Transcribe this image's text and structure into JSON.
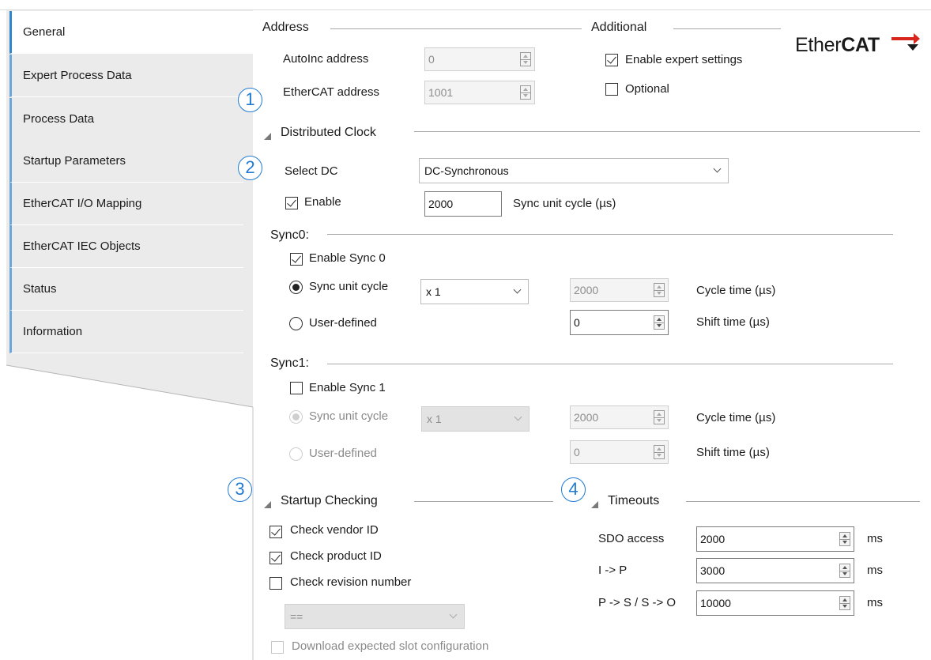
{
  "tabs": [
    {
      "label": "General",
      "active": true
    },
    {
      "label": "Expert Process Data",
      "active": false
    },
    {
      "label": "Process Data",
      "active": false
    },
    {
      "label": "Startup Parameters",
      "active": false
    },
    {
      "label": "EtherCAT I/O Mapping",
      "active": false
    },
    {
      "label": "EtherCAT IEC Objects",
      "active": false
    },
    {
      "label": "Status",
      "active": false
    },
    {
      "label": "Information",
      "active": false
    }
  ],
  "markers": [
    "1",
    "2",
    "3",
    "4"
  ],
  "address": {
    "title": "Address",
    "autoinc_label": "AutoInc address",
    "autoinc_value": "0",
    "ethercat_label": "EtherCAT address",
    "ethercat_value": "1001"
  },
  "additional": {
    "title": "Additional",
    "expert_label": "Enable expert settings",
    "expert_checked": true,
    "optional_label": "Optional",
    "optional_checked": false
  },
  "logo": {
    "text_plain": "Ether",
    "text_bold": "CAT",
    "icon": "ethercat-logo-arrow",
    "accent": "#d9261c"
  },
  "dc": {
    "title": "Distributed Clock",
    "select_label": "Select DC",
    "select_value": "DC-Synchronous",
    "enable_label": "Enable",
    "enable_checked": true,
    "cycle_value": "2000",
    "cycle_label": "Sync unit cycle (µs)"
  },
  "sync0": {
    "title": "Sync0:",
    "enable_label": "Enable Sync 0",
    "enable_checked": true,
    "radio_cycle_label": "Sync unit cycle",
    "multiplier": "x 1",
    "cycle_value": "2000",
    "cycle_time_label": "Cycle time (µs)",
    "radio_user_label": "User-defined",
    "shift_value": "0",
    "shift_time_label": "Shift time (µs)"
  },
  "sync1": {
    "title": "Sync1:",
    "enable_label": "Enable Sync 1",
    "enable_checked": false,
    "radio_cycle_label": "Sync unit cycle",
    "multiplier": "x 1",
    "cycle_value": "2000",
    "cycle_time_label": "Cycle time (µs)",
    "radio_user_label": "User-defined",
    "shift_value": "0",
    "shift_time_label": "Shift time (µs)"
  },
  "startup": {
    "title": "Startup Checking",
    "vendor_label": "Check vendor ID",
    "vendor_checked": true,
    "product_label": "Check product ID",
    "product_checked": true,
    "revision_label": "Check revision number",
    "revision_checked": false,
    "compare_value": "==",
    "download_label": "Download expected slot configuration"
  },
  "timeouts": {
    "title": "Timeouts",
    "rows": [
      {
        "label": "SDO access",
        "value": "2000",
        "unit": "ms"
      },
      {
        "label": "I -> P",
        "value": "3000",
        "unit": "ms"
      },
      {
        "label": "P -> S / S -> O",
        "value": "10000",
        "unit": "ms"
      }
    ]
  }
}
